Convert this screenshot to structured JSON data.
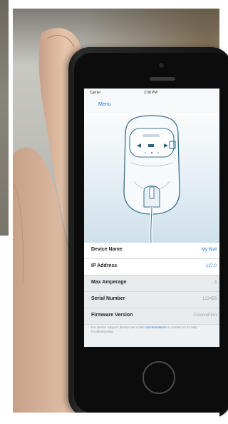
{
  "screen": {
    "status": {
      "carrier": "Carrier",
      "time": "2:38 PM"
    },
    "nav": {
      "menu_label": "Menu"
    },
    "settings": [
      {
        "label": "Device Name",
        "value": "My Wall"
      },
      {
        "label": "IP Address",
        "value": "127.0"
      },
      {
        "label": "Max Amperage",
        "value": "3"
      },
      {
        "label": "Serial Number",
        "value": "123456"
      },
      {
        "label": "Firmware Version",
        "value": "CustomFirm"
      }
    ],
    "footnote_before": "For device support, please see online",
    "footnote_link": "documentation",
    "footnote_after": "or contact us for help troubleshooting."
  },
  "colors": {
    "link_blue": "#1e7ae0",
    "screen_bg": "#eef1f3"
  }
}
